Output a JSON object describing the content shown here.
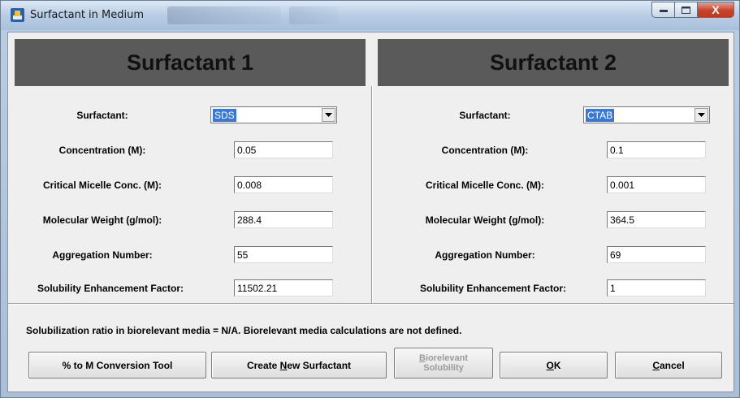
{
  "window": {
    "title": "Surfactant in Medium",
    "close_glyph": "X"
  },
  "surfactant1": {
    "header": "Surfactant 1",
    "surfactant_label": "Surfactant:",
    "surfactant_value": "SDS",
    "concentration_label": "Concentration (M):",
    "concentration_value": "0.05",
    "cmc_label": "Critical Micelle Conc. (M):",
    "cmc_value": "0.008",
    "mw_label": "Molecular Weight (g/mol):",
    "mw_value": "288.4",
    "agg_label": "Aggregation Number:",
    "agg_value": "55",
    "sef_label": "Solubility Enhancement Factor:",
    "sef_value": "11502.21"
  },
  "surfactant2": {
    "header": "Surfactant 2",
    "surfactant_label": "Surfactant:",
    "surfactant_value": "CTAB",
    "concentration_label": "Concentration (M):",
    "concentration_value": "0.1",
    "cmc_label": "Critical Micelle Conc. (M):",
    "cmc_value": "0.001",
    "mw_label": "Molecular Weight (g/mol):",
    "mw_value": "364.5",
    "agg_label": "Aggregation Number:",
    "agg_value": "69",
    "sef_label": "Solubility Enhancement Factor:",
    "sef_value": "1"
  },
  "note": "Solubilization ratio in biorelevant media = N/A.  Biorelevant media calculations are not defined.",
  "buttons": {
    "conversion": "% to M Conversion Tool",
    "create_prefix": "Create ",
    "create_mnemonic": "N",
    "create_suffix": "ew Surfactant",
    "bio_mnemonic": "B",
    "bio_line1_rest": "iorelevant",
    "bio_line2": "Solubility",
    "ok_mnemonic": "O",
    "ok_rest": "K",
    "cancel_mnemonic": "C",
    "cancel_rest": "ancel"
  },
  "colors": {
    "header_bg": "#5a5a5a",
    "selection": "#3a78d4",
    "close_button": "#c7432a"
  }
}
